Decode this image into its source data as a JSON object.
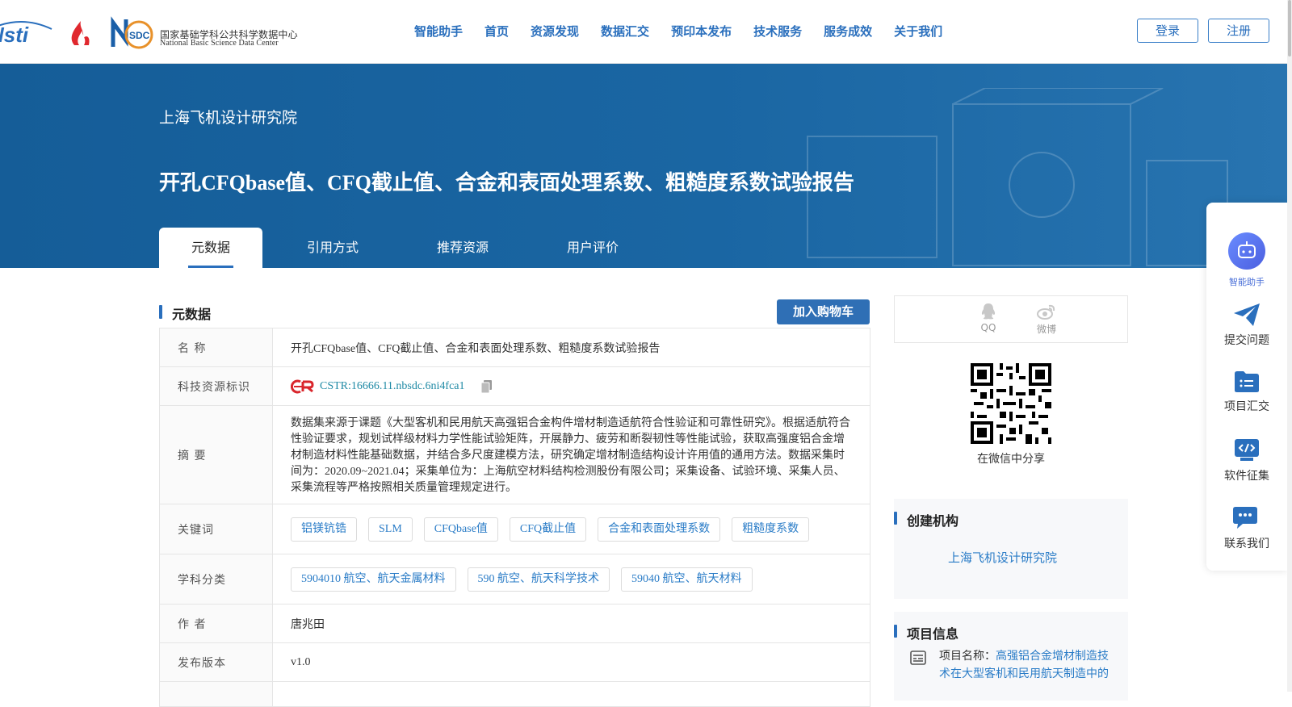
{
  "header": {
    "logo_cn": "国家基础学科公共科学数据中心",
    "logo_en": "National Basic Science Data Center",
    "nav": [
      "智能助手",
      "首页",
      "资源发现",
      "数据汇交",
      "预印本发布",
      "技术服务",
      "服务成效",
      "关于我们"
    ],
    "login": "登录",
    "register": "注册"
  },
  "banner": {
    "org": "上海飞机设计研究院",
    "title": "开孔CFQbase值、CFQ截止值、合金和表面处理系数、粗糙度系数试验报告",
    "tabs": [
      "元数据",
      "引用方式",
      "推荐资源",
      "用户评价"
    ],
    "active_tab": "元数据"
  },
  "metadata": {
    "section_title": "元数据",
    "cart_button": "加入购物车",
    "labels": {
      "name": "名  称",
      "identifier": "科技资源标识",
      "abstract": "摘  要",
      "keywords": "关键词",
      "subjects": "学科分类",
      "author": "作  者",
      "version": "发布版本"
    },
    "name": "开孔CFQbase值、CFQ截止值、合金和表面处理系数、粗糙度系数试验报告",
    "identifier": "CSTR:16666.11.nbsdc.6ni4fca1",
    "abstract": "数据集来源于课题《大型客机和民用航天高强铝合金构件增材制造适航符合性验证和可靠性研究》。根据适航符合性验证要求，规划试样级材料力学性能试验矩阵，开展静力、疲劳和断裂韧性等性能试验，获取高强度铝合金增材制造材料性能基础数据，并结合多尺度建模方法，研究确定增材制造结构设计许用值的通用方法。数据采集时间为：2020.09~2021.04；采集单位为：上海航空材料结构检测股份有限公司；采集设备、试验环境、采集人员、采集流程等严格按照相关质量管理规定进行。",
    "keywords": [
      "铝镁钪锆",
      "SLM",
      "CFQbase值",
      "CFQ截止值",
      "合金和表面处理系数",
      "粗糙度系数"
    ],
    "subjects": [
      "5904010 航空、航天金属材料",
      "590 航空、航天科学技术",
      "59040 航空、航天材料"
    ],
    "author": "唐兆田",
    "version": "v1.0"
  },
  "share": {
    "qq": "QQ",
    "weibo": "微博",
    "wechat_caption": "在微信中分享"
  },
  "org_card": {
    "title": "创建机构",
    "org": "上海飞机设计研究院"
  },
  "project_card": {
    "title": "项目信息",
    "label": "项目名称：",
    "name": "高强铝合金增材制造技术在大型客机和民用航天制造中的"
  },
  "float_toolbar": {
    "ai": "智能助手",
    "submit": "提交问题",
    "project": "项目汇交",
    "software": "软件征集",
    "contact": "联系我们"
  },
  "colors": {
    "brand_blue": "#2a6fbd",
    "banner_blue": "#1a66a3",
    "link_teal": "#1f8aa5"
  }
}
